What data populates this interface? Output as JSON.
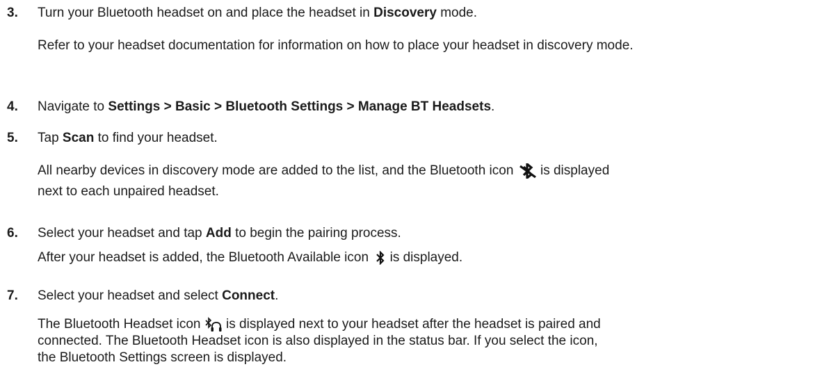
{
  "steps": [
    {
      "number": "3.",
      "main_pre": "Turn your Bluetooth headset on and place the headset in ",
      "main_bold": "Discovery",
      "main_post": " mode.",
      "sub": "Refer to your headset documentation for information on how to place your headset in discovery mode."
    },
    {
      "number": "4.",
      "main_pre": "Navigate to ",
      "main_bold": "Settings > Basic > Bluetooth Settings > Manage BT Headsets",
      "main_post": "."
    },
    {
      "number": "5.",
      "main_pre": "Tap ",
      "main_bold": "Scan",
      "main_post": " to find your headset.",
      "sub_pre": "All nearby devices in discovery mode are added to the list, and the Bluetooth icon",
      "sub_post_line1": " is displayed",
      "sub_line2": "next to each unpaired headset.",
      "icon": "bluetooth-unpaired-icon"
    },
    {
      "number": "6.",
      "main_pre": "Select your headset and tap ",
      "main_bold": "Add",
      "main_post": " to begin the pairing process.",
      "sub_pre": "After your headset is added, the Bluetooth Available icon",
      "sub_post": " is displayed.",
      "icon": "bluetooth-available-icon"
    },
    {
      "number": "7.",
      "main_pre": "Select your headset and select ",
      "main_bold": "Connect",
      "main_post": ".",
      "sub_pre": "The Bluetooth Headset icon",
      "sub_post_line1": " is displayed next to your headset after the headset is paired and",
      "sub_line2": "connected. The Bluetooth Headset icon is also displayed in the status bar. If you select the icon,",
      "sub_line3": "the Bluetooth Settings screen is displayed.",
      "icon": "bluetooth-headset-icon"
    }
  ]
}
